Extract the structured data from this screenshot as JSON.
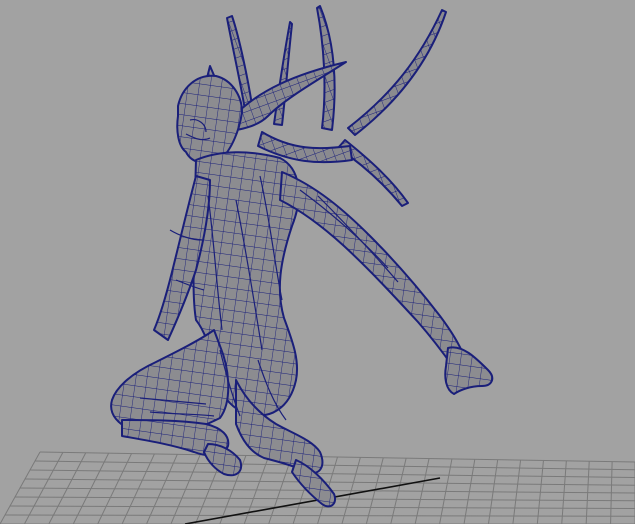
{
  "viewport": {
    "background_color": "#a2a2a2",
    "wireframe_color": "#1a1f7a",
    "mesh_fill_color": "#8c8c90",
    "ground_grid_color": "#7a7a7a",
    "ground_grid_axis_color": "#111111",
    "object_icon": "wireframe-mesh-icon",
    "grid_icon": "ground-grid-icon"
  }
}
